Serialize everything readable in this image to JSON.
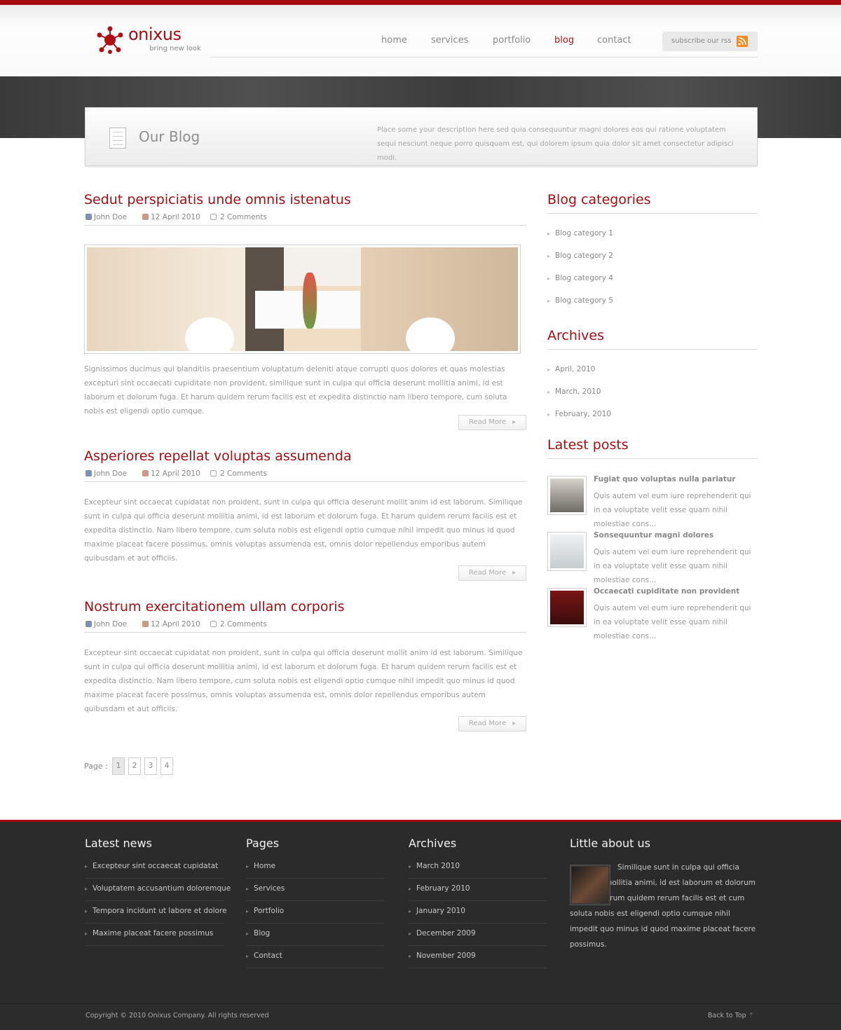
{
  "brand": {
    "name": "onixus",
    "tagline": "bring new look",
    "accent": "#a50d10"
  },
  "nav": {
    "items": [
      "home",
      "services",
      "portfolio",
      "blog",
      "contact"
    ],
    "active": "blog",
    "rss_label": "subscribe our rss"
  },
  "page_header": {
    "title": "Our Blog",
    "description": "Place some your description here sed quia consequuntur magni dolores eos qui ratione voluptatem sequi nesciunt neque porro quisquam est, qui dolorem ipsum quia dolor sit amet consectetur adipisci modi."
  },
  "posts": [
    {
      "title": "Sedut perspiciatis unde omnis istenatus",
      "author": "John Doe",
      "date": "12 April 2010",
      "comments": "2 Comments",
      "body": "Signissimos ducimus qui blanditiis praesentium voluptatum deleniti atque corrupti quos dolores et quas molestias excepturi sint occaecati cupiditate non provident, similique sunt in culpa qui officia deserunt mollitia animi, id est laborum et dolorum fuga. Et harum quidem rerum facilis est et expedita distinctio nam libero tempore, cum soluta nobis est eligendi optio cumque.",
      "read_more": "Read More"
    },
    {
      "title": "Asperiores repellat voluptas assumenda",
      "author": "John Doe",
      "date": "12 April 2010",
      "comments": "2 Comments",
      "body": "Excepteur sint occaecat cupidatat non proident, sunt in culpa qui officia deserunt mollit anim id est laborum. Similique sunt in culpa qui officia deserunt mollitia animi, id est laborum et dolorum fuga. Et harum quidem rerum facilis est et expedita distinctio. Nam libero tempore, cum soluta nobis est eligendi optio cumque nihil impedit quo minus id quod maxime placeat facere possimus, omnis voluptas assumenda est, omnis dolor repellendus emporibus autem quibusdam et aut officiis.",
      "read_more": "Read More"
    },
    {
      "title": "Nostrum exercitationem ullam corporis",
      "author": "John Doe",
      "date": "12 April 2010",
      "comments": "2 Comments",
      "body": "Excepteur sint occaecat cupidatat non proident, sunt in culpa qui officia deserunt mollit anim id est laborum. Similique sunt in culpa qui officia deserunt mollitia animi, id est laborum et dolorum fuga. Et harum quidem rerum facilis est et expedita distinctio. Nam libero tempore, cum soluta nobis est eligendi optio cumque nihil impedit quo minus id quod maxime placeat facere possimus, omnis voluptas assumenda est, omnis dolor repellendus emporibus autem quibusdam et aut officiis.",
      "read_more": "Read More"
    }
  ],
  "pagination": {
    "label": "Page :",
    "pages": [
      "1",
      "2",
      "3",
      "4"
    ],
    "current": "1"
  },
  "sidebar": {
    "categories_title": "Blog categories",
    "categories": [
      "Blog category 1",
      "Blog category 2",
      "Blog category 4",
      "Blog category 5"
    ],
    "archives_title": "Archives",
    "archives": [
      "April, 2010",
      "March, 2010",
      "February, 2010"
    ],
    "latest_title": "Latest posts",
    "latest": [
      {
        "title": "Fugiat quo voluptas nulla pariatur",
        "text": "Quis autem vel eum iure reprehenderit qui in ea voluptate velit esse quam nihil molestiae cons…"
      },
      {
        "title": "Sonsequuntur magni dolores",
        "text": "Quis autem vel eum iure reprehenderit qui in ea voluptate velit esse quam nihil molestiae cons…"
      },
      {
        "title": "Occaecati cupiditate non provident",
        "text": "Quis autem vel eum iure reprehenderit qui in ea voluptate velit esse quam nihil molestiae cons…"
      }
    ]
  },
  "footer": {
    "news_title": "Latest news",
    "news": [
      "Excepteur sint occaecat cupidatat",
      "Voluptatem accusantium doloremque",
      "Tempora incidunt ut labore et dolore",
      "Maxime placeat facere possimus"
    ],
    "pages_title": "Pages",
    "pages": [
      "Home",
      "Services",
      "Portfolio",
      "Blog",
      "Contact"
    ],
    "archives_title": "Archives",
    "archives": [
      "March 2010",
      "February 2010",
      "January 2010",
      "December 2009",
      "November 2009"
    ],
    "about_title": "Little about us",
    "about_text": "Similique sunt in culpa qui officia deserunt mollitia animi, id est laborum et dolorum fuga. Et harum quidem rerum facilis est et cum soluta nobis est eligendi optio cumque nihil impedit quo minus id quod maxime placeat facere possimus.",
    "copyright": "Copyright © 2010 Onixus Company.  All rights reserved",
    "back_to_top": "Back to Top"
  }
}
